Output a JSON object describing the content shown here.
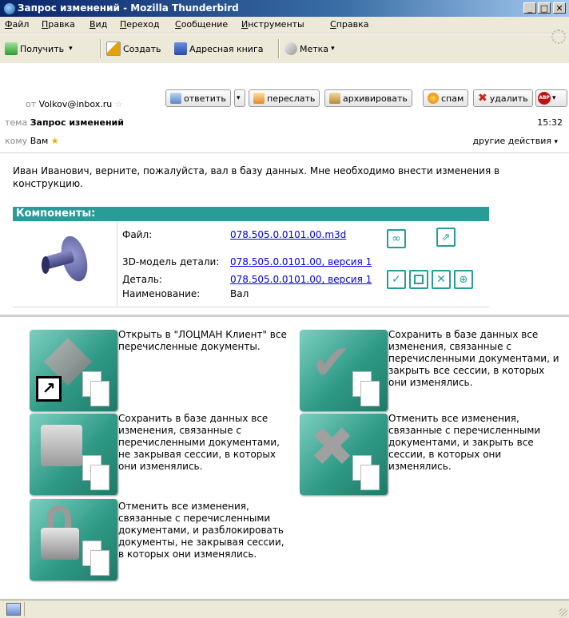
{
  "window": {
    "title": "Запрос изменений - Mozilla Thunderbird"
  },
  "menu": [
    "Файл",
    "Правка",
    "Вид",
    "Переход",
    "Сообщение",
    "Инструменты",
    "Справка"
  ],
  "toolbar": {
    "get": "Получить",
    "write": "Создать",
    "addressbook": "Адресная книга",
    "tag": "Метка"
  },
  "header": {
    "from_label": "от",
    "from": "Volkov@inbox.ru",
    "subject_label": "тема",
    "subject": "Запрос изменений",
    "to_label": "кому",
    "to": "Вам",
    "time": "15:32",
    "other_actions": "другие действия",
    "buttons": {
      "reply": "ответить",
      "forward": "переслать",
      "archive": "архивировать",
      "spam": "спам",
      "delete": "удалить"
    }
  },
  "message": {
    "body": "Иван Иванович, верните, пожалуйста, вал в базу данных. Мне необходимо внести изменения в конструкцию.",
    "components_title": "Компоненты:",
    "file_label": "Файл:",
    "file_link": "078.505.0.0101.00.m3d",
    "model_label": "3D-модель детали:",
    "model_link": "078.505.0.0101.00, версия 1",
    "part_label": "Деталь:",
    "part_link": "078.505.0.0101.00, версия 1",
    "name_label": "Наименование:",
    "name_value": "Вал"
  },
  "actions": {
    "open": "Открыть в \"ЛОЦМАН Клиент\" все перечисленные документы.",
    "save_keep": "Сохранить в базе данных все изменения, связанные с перечисленными документами, не закрывая сессии, в которых они изменялись.",
    "cancel_unlock": "Отменить все изменения, связанные с перечисленными документами, и разблокировать документы, не закрывая сессии, в которых они изменялись.",
    "save_close": "Сохранить в базе данных все изменения, связанные с перечисленными документами, и закрыть все сессии, в которых они изменялись.",
    "cancel_close": "Отменить все изменения, связанные с перечисленными документами, и закрыть все сессии, в которых они изменялись."
  }
}
